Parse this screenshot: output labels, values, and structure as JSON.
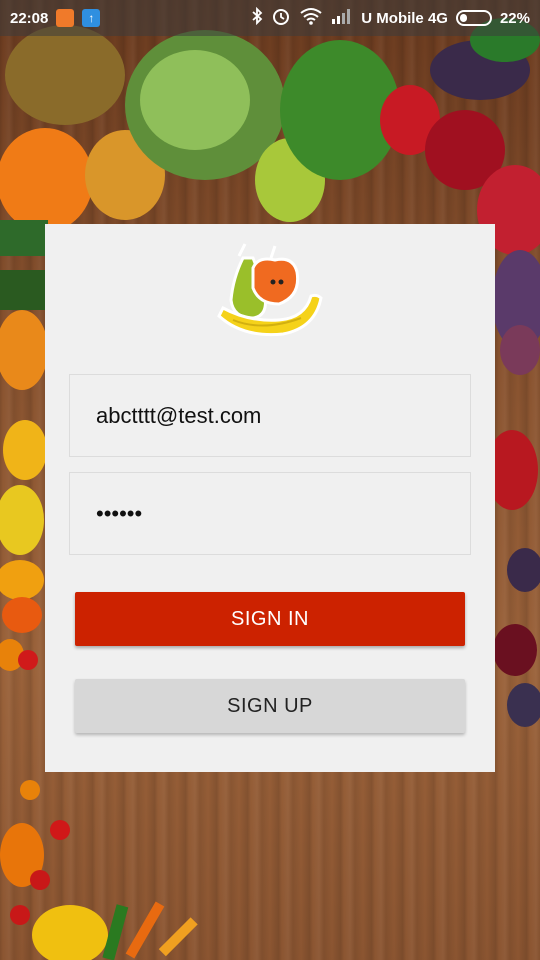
{
  "status_bar": {
    "time": "22:08",
    "carrier": "U Mobile 4G",
    "battery": "22%",
    "battery_level": 0.22
  },
  "login": {
    "email_value": "abctttt@test.com",
    "password_value": "••••••",
    "sign_in_label": "SIGN IN",
    "sign_up_label": "SIGN UP"
  },
  "colors": {
    "sign_in_bg": "#cc2200",
    "sign_up_bg": "#d7d7d7",
    "card_bg": "#f0f0f0"
  },
  "icons": [
    "bluetooth-icon",
    "alarm-icon",
    "wifi-icon",
    "signal-icon",
    "battery-icon",
    "app-logo-icon"
  ]
}
